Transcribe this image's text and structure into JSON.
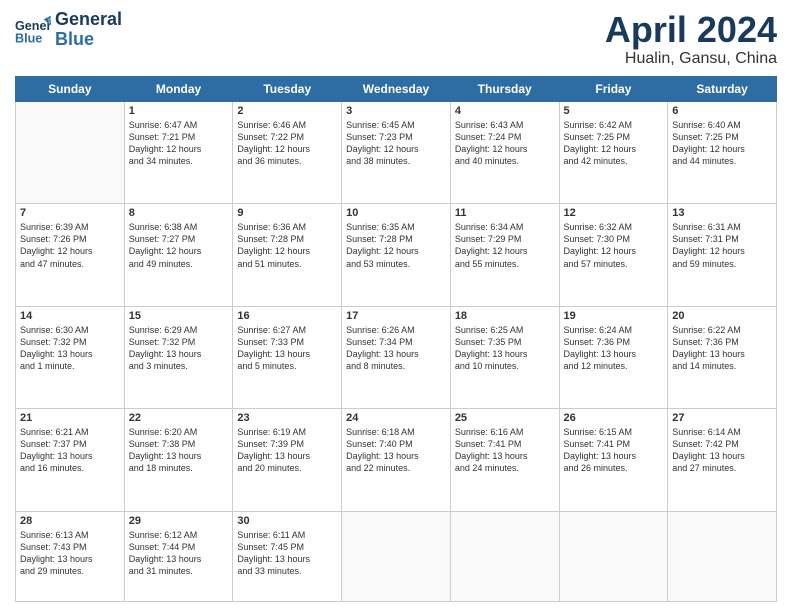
{
  "logo": {
    "line1": "General",
    "line2": "Blue"
  },
  "title": "April 2024",
  "location": "Hualin, Gansu, China",
  "days_of_week": [
    "Sunday",
    "Monday",
    "Tuesday",
    "Wednesday",
    "Thursday",
    "Friday",
    "Saturday"
  ],
  "weeks": [
    [
      {
        "day": "",
        "content": ""
      },
      {
        "day": "1",
        "content": "Sunrise: 6:47 AM\nSunset: 7:21 PM\nDaylight: 12 hours\nand 34 minutes."
      },
      {
        "day": "2",
        "content": "Sunrise: 6:46 AM\nSunset: 7:22 PM\nDaylight: 12 hours\nand 36 minutes."
      },
      {
        "day": "3",
        "content": "Sunrise: 6:45 AM\nSunset: 7:23 PM\nDaylight: 12 hours\nand 38 minutes."
      },
      {
        "day": "4",
        "content": "Sunrise: 6:43 AM\nSunset: 7:24 PM\nDaylight: 12 hours\nand 40 minutes."
      },
      {
        "day": "5",
        "content": "Sunrise: 6:42 AM\nSunset: 7:25 PM\nDaylight: 12 hours\nand 42 minutes."
      },
      {
        "day": "6",
        "content": "Sunrise: 6:40 AM\nSunset: 7:25 PM\nDaylight: 12 hours\nand 44 minutes."
      }
    ],
    [
      {
        "day": "7",
        "content": "Sunrise: 6:39 AM\nSunset: 7:26 PM\nDaylight: 12 hours\nand 47 minutes."
      },
      {
        "day": "8",
        "content": "Sunrise: 6:38 AM\nSunset: 7:27 PM\nDaylight: 12 hours\nand 49 minutes."
      },
      {
        "day": "9",
        "content": "Sunrise: 6:36 AM\nSunset: 7:28 PM\nDaylight: 12 hours\nand 51 minutes."
      },
      {
        "day": "10",
        "content": "Sunrise: 6:35 AM\nSunset: 7:28 PM\nDaylight: 12 hours\nand 53 minutes."
      },
      {
        "day": "11",
        "content": "Sunrise: 6:34 AM\nSunset: 7:29 PM\nDaylight: 12 hours\nand 55 minutes."
      },
      {
        "day": "12",
        "content": "Sunrise: 6:32 AM\nSunset: 7:30 PM\nDaylight: 12 hours\nand 57 minutes."
      },
      {
        "day": "13",
        "content": "Sunrise: 6:31 AM\nSunset: 7:31 PM\nDaylight: 12 hours\nand 59 minutes."
      }
    ],
    [
      {
        "day": "14",
        "content": "Sunrise: 6:30 AM\nSunset: 7:32 PM\nDaylight: 13 hours\nand 1 minute."
      },
      {
        "day": "15",
        "content": "Sunrise: 6:29 AM\nSunset: 7:32 PM\nDaylight: 13 hours\nand 3 minutes."
      },
      {
        "day": "16",
        "content": "Sunrise: 6:27 AM\nSunset: 7:33 PM\nDaylight: 13 hours\nand 5 minutes."
      },
      {
        "day": "17",
        "content": "Sunrise: 6:26 AM\nSunset: 7:34 PM\nDaylight: 13 hours\nand 8 minutes."
      },
      {
        "day": "18",
        "content": "Sunrise: 6:25 AM\nSunset: 7:35 PM\nDaylight: 13 hours\nand 10 minutes."
      },
      {
        "day": "19",
        "content": "Sunrise: 6:24 AM\nSunset: 7:36 PM\nDaylight: 13 hours\nand 12 minutes."
      },
      {
        "day": "20",
        "content": "Sunrise: 6:22 AM\nSunset: 7:36 PM\nDaylight: 13 hours\nand 14 minutes."
      }
    ],
    [
      {
        "day": "21",
        "content": "Sunrise: 6:21 AM\nSunset: 7:37 PM\nDaylight: 13 hours\nand 16 minutes."
      },
      {
        "day": "22",
        "content": "Sunrise: 6:20 AM\nSunset: 7:38 PM\nDaylight: 13 hours\nand 18 minutes."
      },
      {
        "day": "23",
        "content": "Sunrise: 6:19 AM\nSunset: 7:39 PM\nDaylight: 13 hours\nand 20 minutes."
      },
      {
        "day": "24",
        "content": "Sunrise: 6:18 AM\nSunset: 7:40 PM\nDaylight: 13 hours\nand 22 minutes."
      },
      {
        "day": "25",
        "content": "Sunrise: 6:16 AM\nSunset: 7:41 PM\nDaylight: 13 hours\nand 24 minutes."
      },
      {
        "day": "26",
        "content": "Sunrise: 6:15 AM\nSunset: 7:41 PM\nDaylight: 13 hours\nand 26 minutes."
      },
      {
        "day": "27",
        "content": "Sunrise: 6:14 AM\nSunset: 7:42 PM\nDaylight: 13 hours\nand 27 minutes."
      }
    ],
    [
      {
        "day": "28",
        "content": "Sunrise: 6:13 AM\nSunset: 7:43 PM\nDaylight: 13 hours\nand 29 minutes."
      },
      {
        "day": "29",
        "content": "Sunrise: 6:12 AM\nSunset: 7:44 PM\nDaylight: 13 hours\nand 31 minutes."
      },
      {
        "day": "30",
        "content": "Sunrise: 6:11 AM\nSunset: 7:45 PM\nDaylight: 13 hours\nand 33 minutes."
      },
      {
        "day": "",
        "content": ""
      },
      {
        "day": "",
        "content": ""
      },
      {
        "day": "",
        "content": ""
      },
      {
        "day": "",
        "content": ""
      }
    ]
  ]
}
